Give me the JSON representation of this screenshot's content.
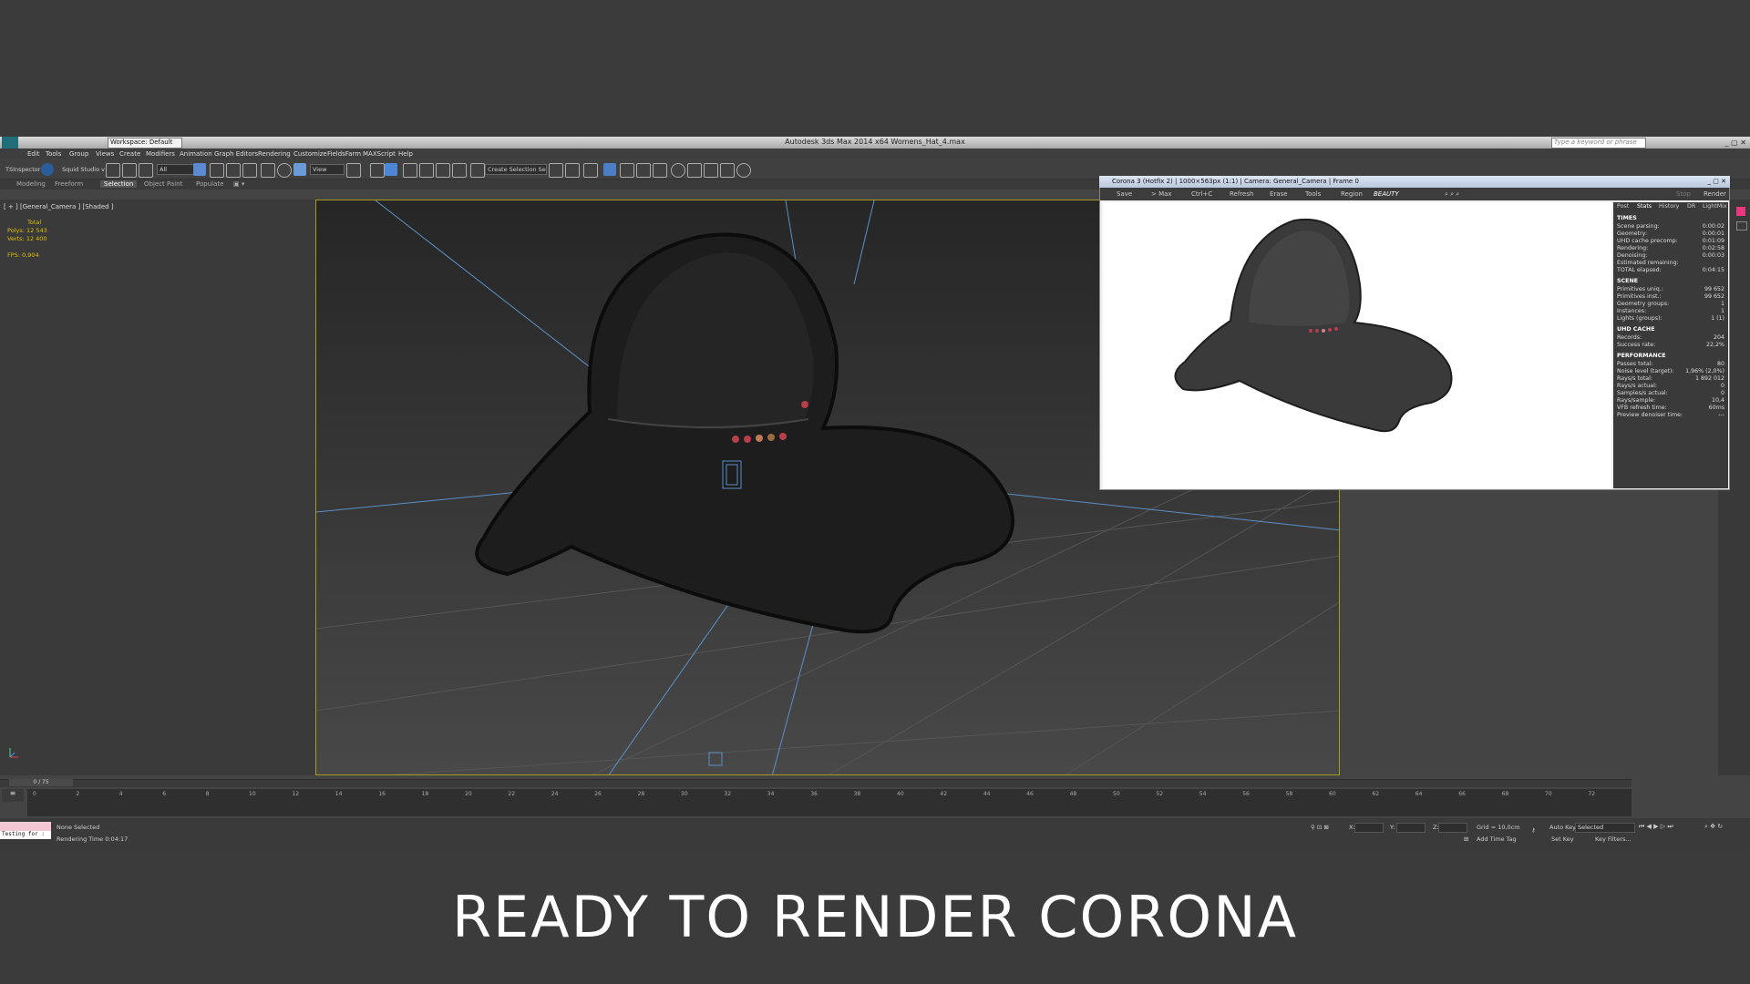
{
  "titlebar": {
    "title": "Autodesk 3ds Max  2014 x64     Womens_Hat_4.max",
    "workspace": "Workspace: Default",
    "search_placeholder": "Type a keyword or phrase"
  },
  "menu": [
    "Edit",
    "Tools",
    "Group",
    "Views",
    "Create",
    "Modifiers",
    "Animation",
    "Graph Editors",
    "Rendering",
    "Customize",
    "FieldsFarm",
    "MAXScript",
    "Help"
  ],
  "toolbar": {
    "ts_inspector": "TSInspector",
    "squid_studio": "Squid Studio v",
    "filter": "All",
    "view": "View",
    "selection_set": "Create Selection Se"
  },
  "ribbon": [
    "Modeling",
    "Freeform",
    "Selection",
    "Object Paint",
    "Populate"
  ],
  "viewport": {
    "label": "[ + ] [General_Camera ] [Shaded ]",
    "stats": {
      "total_label": "Total",
      "polys_label": "Polys:",
      "polys": "12 543",
      "verts_label": "Verts:",
      "verts": "12 400",
      "fps_label": "FPS:",
      "fps": "0,904"
    }
  },
  "timeline": {
    "frame": "0 / 75",
    "ticks": [
      "0",
      "2",
      "4",
      "6",
      "8",
      "10",
      "12",
      "14",
      "16",
      "18",
      "20",
      "22",
      "24",
      "26",
      "28",
      "30",
      "32",
      "34",
      "36",
      "38",
      "40",
      "42",
      "44",
      "46",
      "48",
      "50",
      "52",
      "54",
      "56",
      "58",
      "60",
      "62",
      "64",
      "66",
      "68",
      "70",
      "72"
    ]
  },
  "status": {
    "maxscript": "Testing for :",
    "selection": "None Selected",
    "rendering_time": "Rendering Time  0:04:17",
    "x_label": "X:",
    "y_label": "Y:",
    "z_label": "Z:",
    "grid": "Grid = 10,0cm",
    "add_time_tag": "Add Time Tag",
    "auto_key": "Auto Key",
    "selected": "Selected",
    "set_key": "Set Key",
    "key_filters": "Key Filters..."
  },
  "vfb": {
    "title": "Corona 3 (Hotfix 2) | 1000×563px (1:1) | Camera: General_Camera | Frame 0",
    "tools": [
      "Save",
      "> Max",
      "Ctrl+C",
      "Refresh",
      "Erase",
      "Tools",
      "Region",
      "BEAUTY",
      "Stop",
      "Render"
    ],
    "tabs": [
      "Post",
      "Stats",
      "History",
      "DR",
      "LightMix"
    ],
    "sections": [
      {
        "name": "TIMES",
        "rows": [
          [
            "Scene parsing:",
            "0:00:02"
          ],
          [
            "Geometry:",
            "0:00:01"
          ],
          [
            "UHD cache precomp:",
            "0:01:09"
          ],
          [
            "Rendering:",
            "0:02:58"
          ],
          [
            "Denoising:",
            "0:00:03"
          ],
          [
            "Estimated remaining:",
            ""
          ],
          [
            "TOTAL elapsed:",
            "0:04:15"
          ]
        ]
      },
      {
        "name": "SCENE",
        "rows": [
          [
            "Primitives uniq.:",
            "99 652"
          ],
          [
            "Primitives inst.:",
            "99 652"
          ],
          [
            "Geometry groups:",
            "1"
          ],
          [
            "Instances:",
            "1"
          ],
          [
            "Lights (groups):",
            "1 (1)"
          ]
        ]
      },
      {
        "name": "UHD CACHE",
        "rows": [
          [
            "Records:",
            "204"
          ],
          [
            "Success rate:",
            "22,2%"
          ]
        ]
      },
      {
        "name": "PERFORMANCE",
        "rows": [
          [
            "Passes total:",
            "80"
          ],
          [
            "Noise level (target):",
            "1,96% (2,0%)"
          ],
          [
            "Rays/s total:",
            "1 892 012"
          ],
          [
            "Rays/s actual:",
            "0"
          ],
          [
            "Samples/s actual:",
            "0"
          ],
          [
            "Rays/sample:",
            "10,4"
          ],
          [
            "VFB refresh time:",
            "60ms"
          ],
          [
            "Preview denoiser time:",
            "---"
          ]
        ]
      }
    ]
  },
  "caption": "READY TO RENDER  CORONA"
}
